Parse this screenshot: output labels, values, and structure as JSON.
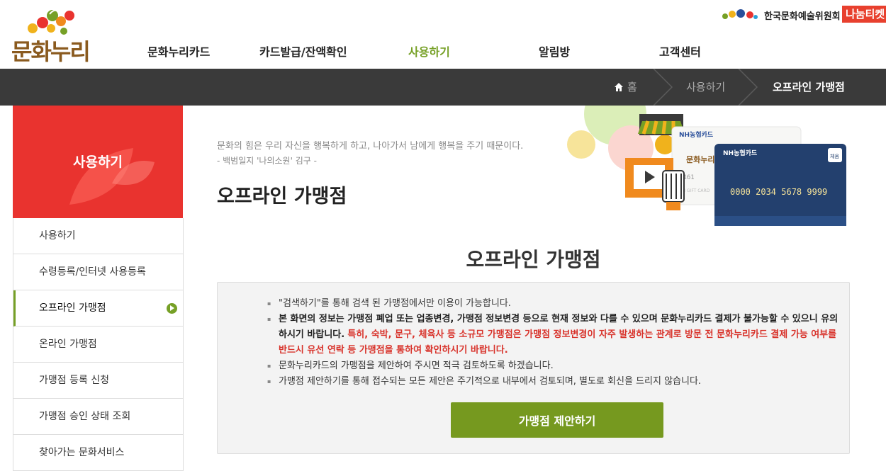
{
  "header": {
    "logo_text": "문화누리",
    "org_name": "한국문화예술위원회",
    "nanum_logo": "나눔티켓",
    "gnb": [
      {
        "label": "문화누리카드"
      },
      {
        "label": "카드발급/잔액확인"
      },
      {
        "label": "사용하기"
      },
      {
        "label": "알림방"
      },
      {
        "label": "고객센터"
      }
    ]
  },
  "breadcrumb": [
    "홈",
    "사용하기",
    "오프라인 가맹점"
  ],
  "sidebar": {
    "title": "사용하기",
    "items": [
      {
        "label": "사용하기"
      },
      {
        "label": "수령등록/인터넷 사용등록"
      },
      {
        "label": "오프라인 가맹점"
      },
      {
        "label": "온라인 가맹점"
      },
      {
        "label": "가맹점 등록 신청"
      },
      {
        "label": "가맹점 승인 상태 조회"
      },
      {
        "label": "찾아가는 문화서비스"
      }
    ]
  },
  "main": {
    "quote": "문화의 힘은 우리 자신을 행복하게 하고, 나아가서 남에게 행복을 주기 때문이다.",
    "quote_source": "- 백범일지 '나의소원' 김구 -",
    "page_title": "오프라인 가맹점",
    "section_title": "오프라인 가맹점",
    "notice": {
      "item1": "\"검색하기\"를 통해 검색 된 가맹점에서만 이용이 가능합니다.",
      "item2_bold": "본 화면의 정보는 가맹점 폐업 또는 업종변경, 가맹점 정보변경 등으로 현재 정보와 다를 수 있으며 문화누리카드 결제가 불가능할 수 있으니 유의하시기 바랍니다.",
      "item2_red": "특히, 숙박, 문구, 체육사 등 소규모 가맹점은 가맹점 정보변경이 자주 발생하는 관계로 방문 전 문화누리카드 결제 가능 여부를 반드시 유선 연락 등 가맹점을 통하여 확인하시기 바랍니다.",
      "item3": "문화누리카드의 가맹점을 제안하여 주시면 적극 검토하도록 하겠습니다.",
      "item4": "가맹점 제안하기를 통해 접수되는 모든 제안은 주기적으로 내부에서 검토되며, 별도로 회신을 드리지 않습니다."
    },
    "propose_button": "가맹점 제안하기"
  },
  "illustration": {
    "card_brand": "NH농협카드",
    "card_number": "0000 2034 5678 9999",
    "card_badge": "체움",
    "gift_card_text": "NH GIFT CARD",
    "gift_card_logo": "문화누리",
    "gift_card_number": "9461"
  },
  "colors": {
    "accent_green": "#76a026",
    "button_green": "#76991f",
    "sidebar_red": "#e9332f",
    "crumb_bar": "#3a3a3a",
    "notice_red": "#d8322a"
  }
}
